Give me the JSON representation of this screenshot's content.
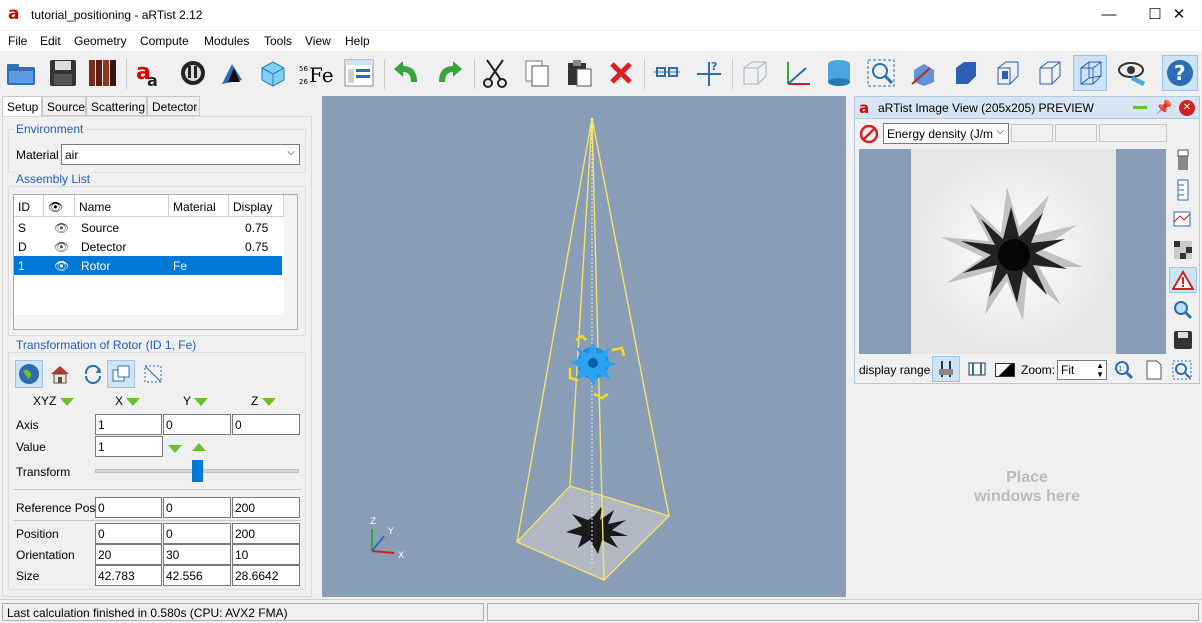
{
  "window": {
    "title": "tutorial_positioning - aRTist 2.12",
    "logo": "a",
    "min": "—",
    "max": "☐",
    "close": "✕"
  },
  "menu": [
    "File",
    "Edit",
    "Geometry",
    "Compute",
    "Modules",
    "Tools",
    "View",
    "Help"
  ],
  "tabs": [
    "Setup",
    "Source",
    "Scattering",
    "Detector"
  ],
  "environment": {
    "title": "Environment",
    "material_label": "Material",
    "material_value": "air"
  },
  "assembly": {
    "title": "Assembly List",
    "headers": [
      "ID",
      "",
      "Name",
      "Material",
      "Display"
    ],
    "rows": [
      {
        "id": "S",
        "name": "Source",
        "material": "",
        "display": "0.75"
      },
      {
        "id": "D",
        "name": "Detector",
        "material": "",
        "display": "0.75"
      },
      {
        "id": "1",
        "name": "Rotor",
        "material": "Fe",
        "display": ""
      }
    ]
  },
  "transform": {
    "title": "Transformation of Rotor (ID 1, Fe)",
    "xyz_label": "XYZ",
    "x_label": "X",
    "y_label": "Y",
    "z_label": "Z",
    "axis_label": "Axis",
    "axis": [
      "1",
      "0",
      "0"
    ],
    "value_label": "Value",
    "value": "1",
    "transform_label": "Transform",
    "slider_level": 0.5,
    "refpos_label": "Reference Pos.",
    "refpos": [
      "0",
      "0",
      "200"
    ],
    "position_label": "Position",
    "position": [
      "0",
      "0",
      "200"
    ],
    "orientation_label": "Orientation",
    "orientation": [
      "20",
      "30",
      "10"
    ],
    "size_label": "Size",
    "size": [
      "42.783",
      "42.556",
      "28.6642"
    ]
  },
  "axes_indicator": {
    "z": "Z",
    "y": "Y",
    "x": "X"
  },
  "image_view": {
    "title": "aRTist Image View (205x205) PREVIEW",
    "logo": "a",
    "quantity": "Energy density (J/m",
    "display_range_label": "display range",
    "zoom_label": "Zoom:",
    "zoom_value": "Fit"
  },
  "placeholder": "Place windows here",
  "status": {
    "message": "Last calculation finished in 0.580s (CPU: AVX2 FMA)"
  },
  "colors": {
    "accent": "#0078d7",
    "group_title": "#1f5fbf",
    "viewport": "#8a9db6",
    "frustum": "#f3e36a"
  }
}
